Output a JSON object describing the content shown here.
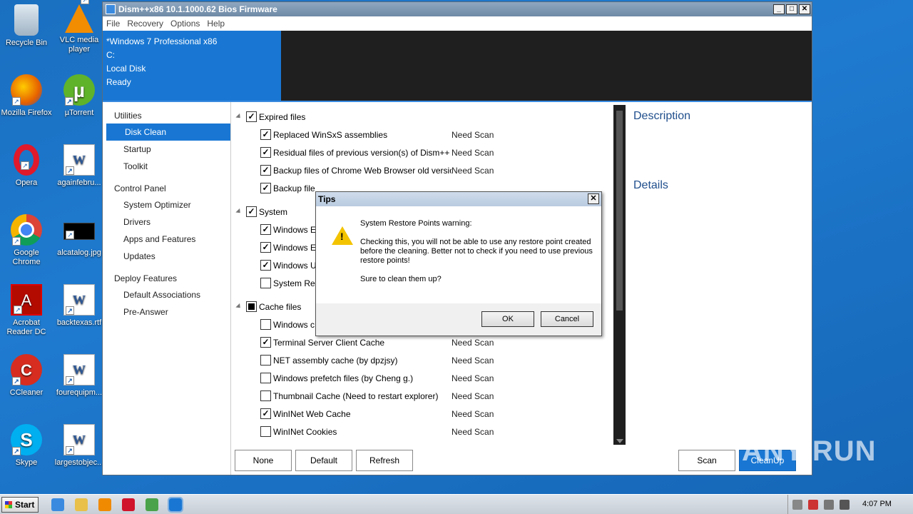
{
  "desktop": {
    "icons": [
      {
        "label": "Recycle Bin",
        "icon": "recycle-bin-icon"
      },
      {
        "label": "VLC media player",
        "icon": "vlc-icon"
      },
      {
        "label": "Mozilla Firefox",
        "icon": "firefox-icon"
      },
      {
        "label": "µTorrent",
        "icon": "utorrent-icon"
      },
      {
        "label": "Opera",
        "icon": "opera-icon"
      },
      {
        "label": "againfebru...",
        "icon": "word-doc-icon"
      },
      {
        "label": "Google Chrome",
        "icon": "chrome-icon"
      },
      {
        "label": "alcatalog.jpg",
        "icon": "image-file-icon"
      },
      {
        "label": "Acrobat Reader DC",
        "icon": "acrobat-icon"
      },
      {
        "label": "backtexas.rtf",
        "icon": "word-doc-icon"
      },
      {
        "label": "CCleaner",
        "icon": "ccleaner-icon"
      },
      {
        "label": "fourequipm...",
        "icon": "word-doc-icon"
      },
      {
        "label": "Skype",
        "icon": "skype-icon"
      },
      {
        "label": "largestobjec...",
        "icon": "word-doc-icon"
      }
    ],
    "watermark": "ANY RUN"
  },
  "window": {
    "title": "Dism++x86 10.1.1000.62 Bios Firmware",
    "controls": {
      "minimize": "_",
      "maximize": "□",
      "close": "✕"
    },
    "menu": [
      "File",
      "Recovery",
      "Options",
      "Help"
    ],
    "header": {
      "os": "*Windows 7 Professional x86",
      "drive": "C:",
      "disk": "Local Disk",
      "status": "Ready"
    },
    "sidebar": {
      "groups": [
        {
          "label": "Utilities",
          "items": [
            "Disk Clean",
            "Startup",
            "Toolkit"
          ]
        },
        {
          "label": "Control Panel",
          "items": [
            "System Optimizer",
            "Drivers",
            "Apps and Features",
            "Updates"
          ]
        },
        {
          "label": "Deploy Features",
          "items": [
            "Default Associations",
            "Pre-Answer"
          ]
        }
      ],
      "active": "Disk Clean"
    },
    "list": {
      "groups": [
        {
          "label": "Expired files",
          "state": "checked",
          "rows": [
            {
              "name": "Replaced WinSxS assemblies",
              "status": "Need Scan",
              "checked": true
            },
            {
              "name": "Residual files of previous version(s) of Dism++",
              "status": "Need Scan",
              "checked": true
            },
            {
              "name": "Backup files of Chrome Web Browser old versio",
              "status": "Need Scan",
              "checked": true
            },
            {
              "name": "Backup file",
              "status": "",
              "checked": true
            }
          ]
        },
        {
          "label": "System",
          "state": "checked",
          "rows": [
            {
              "name": "Windows E",
              "status": "",
              "checked": true
            },
            {
              "name": "Windows E",
              "status": "",
              "checked": true
            },
            {
              "name": "Windows U",
              "status": "",
              "checked": true
            },
            {
              "name": "System Res",
              "status": "",
              "checked": false
            }
          ]
        },
        {
          "label": "Cache files",
          "state": "partial",
          "rows": [
            {
              "name": "Windows c",
              "status": "",
              "checked": false
            },
            {
              "name": "Terminal Server Client Cache",
              "status": "Need Scan",
              "checked": true
            },
            {
              "name": "NET assembly cache (by dpzjsy)",
              "status": "Need Scan",
              "checked": false
            },
            {
              "name": "Windows prefetch files (by Cheng g.)",
              "status": "Need Scan",
              "checked": false
            },
            {
              "name": "Thumbnail Cache (Need to restart explorer)",
              "status": "Need Scan",
              "checked": false
            },
            {
              "name": "WinINet Web Cache",
              "status": "Need Scan",
              "checked": true
            },
            {
              "name": "WinINet Cookies",
              "status": "Need Scan",
              "checked": false
            }
          ]
        }
      ]
    },
    "right": {
      "description": "Description",
      "details": "Details"
    },
    "buttons": {
      "none": "None",
      "default": "Default",
      "refresh": "Refresh",
      "scan": "Scan",
      "cleanup": "CleanUp"
    }
  },
  "dialog": {
    "title": "Tips",
    "close": "✕",
    "heading": "System Restore Points warning:",
    "message": "Checking this, you will not be able to use any restore point created before the cleaning. Better not to check if you need to use previous restore points!",
    "question": "Sure to clean them up?",
    "ok": "OK",
    "cancel": "Cancel"
  },
  "taskbar": {
    "start": "Start",
    "clock": "4:07 PM",
    "pinned": [
      {
        "icon": "internet-explorer-icon",
        "color": "#3a8be0"
      },
      {
        "icon": "explorer-folder-icon",
        "color": "#e8c04a"
      },
      {
        "icon": "media-player-icon",
        "color": "#f08a00"
      },
      {
        "icon": "opera-taskbar-icon",
        "color": "#d0142b"
      },
      {
        "icon": "chrome-taskbar-icon",
        "color": "#4aa34a"
      },
      {
        "icon": "dism-taskbar-icon",
        "color": "#1977d3"
      }
    ]
  }
}
